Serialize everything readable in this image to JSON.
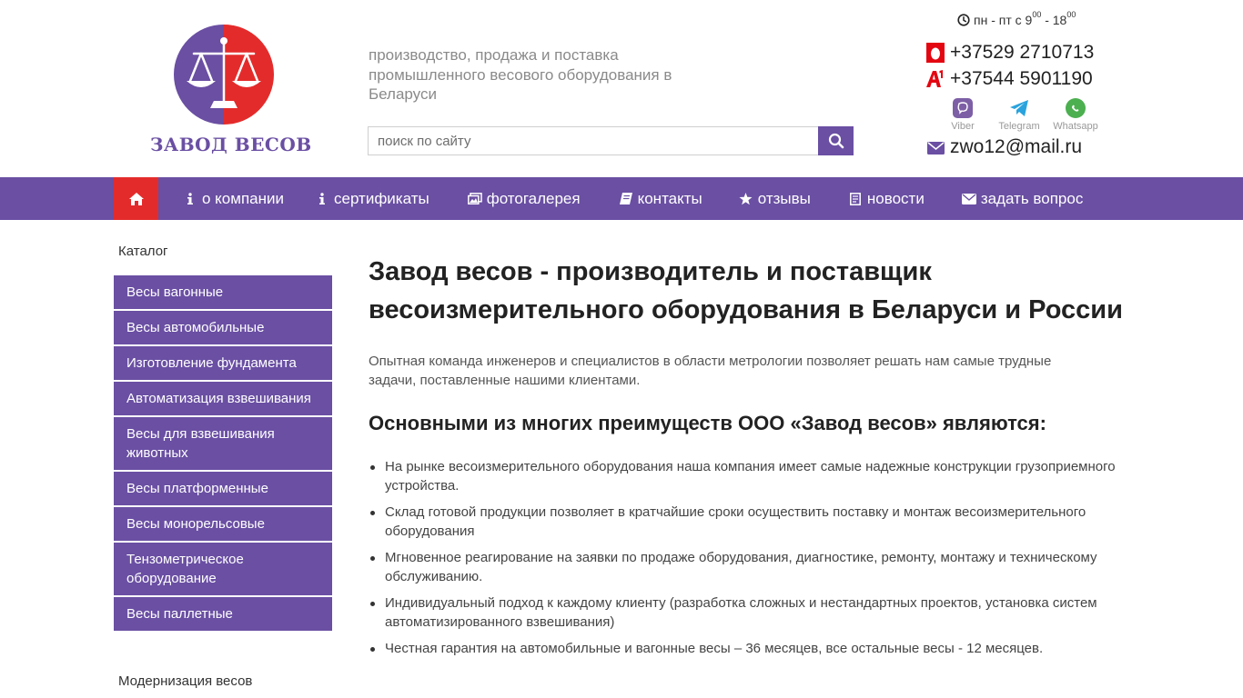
{
  "header": {
    "logo_text": "ЗАВОД ВЕСОВ",
    "tagline": "производство, продажа и поставка промышленного весового оборудования в Беларуси",
    "search_placeholder": "поиск по сайту"
  },
  "contacts": {
    "hours_prefix": "пн - пт с 9",
    "hours_start_sup": "00",
    "hours_mid": " - 18",
    "hours_end_sup": "00",
    "phone_1": "+37529 2710713",
    "phone_1_operator": "mts-icon",
    "phone_2": "+37544 5901190",
    "phone_2_operator": "a1-icon",
    "messengers": [
      {
        "label": "Viber",
        "color": "#7d5fa6"
      },
      {
        "label": "Telegram",
        "color": "#2aa3dd"
      },
      {
        "label": "Whatsapp",
        "color": "#4caf50"
      }
    ],
    "email": "zwo12@mail.ru"
  },
  "nav": {
    "items": [
      {
        "label": "о компании",
        "icon": "info-icon"
      },
      {
        "label": "сертификаты",
        "icon": "info-icon"
      },
      {
        "label": "фотогалерея",
        "icon": "photo-icon"
      },
      {
        "label": "контакты",
        "icon": "book-icon"
      },
      {
        "label": "отзывы",
        "icon": "star-icon"
      },
      {
        "label": "новости",
        "icon": "news-icon"
      },
      {
        "label": "задать вопрос",
        "icon": "envelope-icon"
      }
    ]
  },
  "sidebar": {
    "title": "Каталог",
    "items": [
      "Весы вагонные",
      "Весы автомобильные",
      "Изготовление фундамента",
      "Автоматизация взвешивания",
      "Весы для взвешивания животных",
      "Весы платформенные",
      "Весы монорельсовые",
      "Тензометрическое оборудование",
      "Весы паллетные"
    ],
    "title_2": "Модернизация весов"
  },
  "main": {
    "h1": "Завод весов - производитель и поставщик весоизмерительного оборудования в Беларуси и России",
    "intro": "Опытная команда инженеров и специалистов в области метрологии позволяет решать нам самые трудные задачи, поставленные нашими клиентами.",
    "h2": "Основными из многих преимуществ ООО «Завод весов» являются:",
    "advantages": [
      "На рынке весоизмерительного оборудования наша компания имеет самые надежные конструкции грузоприемного устройства.",
      "Склад готовой продукции позволяет в кратчайшие сроки осуществить поставку и монтаж весоизмерительного оборудования",
      "Мгновенное реагирование на заявки по продаже оборудования, диагностике, ремонту, монтажу и техническому обслуживанию.",
      "Индивидуальный подход к каждому клиенту (разработка сложных и нестандартных проектов, установка систем автоматизированного взвешивания)",
      "Честная гарантия на автомобильные и вагонные весы – 36 месяцев, все остальные весы - 12 месяцев."
    ]
  },
  "colors": {
    "brand_purple": "#6a4fa3",
    "brand_red": "#e42b2b"
  }
}
